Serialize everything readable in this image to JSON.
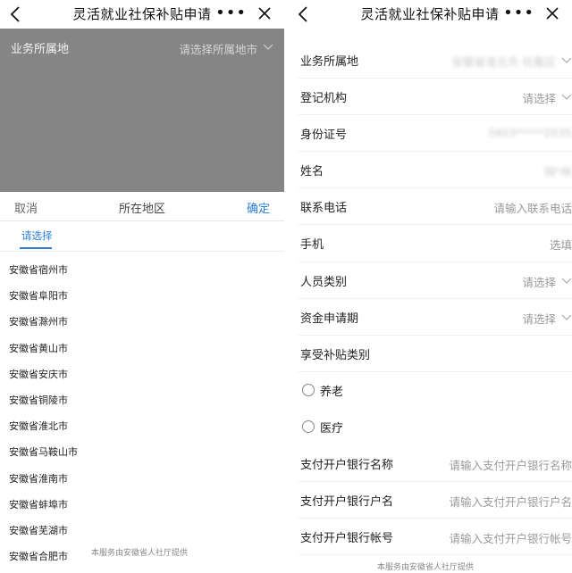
{
  "left": {
    "header": {
      "title": "灵活就业社保补贴申请",
      "more": "•••"
    },
    "overlay": {
      "label": "业务所属地",
      "placeholder": "请选择所属地市"
    },
    "picker": {
      "cancel": "取消",
      "title": "所在地区",
      "confirm": "确定",
      "tab": "请选择",
      "cities": [
        "安徽省宿州市",
        "安徽省阜阳市",
        "安徽省滁州市",
        "安徽省黄山市",
        "安徽省安庆市",
        "安徽省铜陵市",
        "安徽省淮北市",
        "安徽省马鞍山市",
        "安徽省淮南市",
        "安徽省蚌埠市",
        "安徽省芜湖市",
        "安徽省合肥市"
      ]
    },
    "footer": "本服务由安徽省人社厅提供"
  },
  "right": {
    "header": {
      "title": "灵活就业社保补贴申请",
      "more": "•••"
    },
    "form": {
      "region": {
        "label": "业务所属地",
        "value": "安徽省淮北市 杜集区"
      },
      "registration_org": {
        "label": "登记机构",
        "placeholder": "请选择"
      },
      "id_number": {
        "label": "身份证号",
        "value": "3403*****2035"
      },
      "name": {
        "label": "姓名",
        "value": "钱*林"
      },
      "phone": {
        "label": "联系电话",
        "placeholder": "请输入联系电话"
      },
      "mobile": {
        "label": "手机",
        "placeholder": "选填"
      },
      "person_type": {
        "label": "人员类别",
        "placeholder": "请选择"
      },
      "fund_period": {
        "label": "资金申请期",
        "placeholder": "请选择"
      },
      "subsidy_type": {
        "label": "享受补贴类别"
      },
      "pension": {
        "label": "养老"
      },
      "medical": {
        "label": "医疗"
      },
      "bank_name": {
        "label": "支付开户银行名称",
        "placeholder": "请输入支付开户银行名称"
      },
      "bank_account_name": {
        "label": "支付开户银行户名",
        "placeholder": "请输入支付开户银行户名"
      },
      "bank_account_no": {
        "label": "支付开户银行帐号",
        "placeholder": "请输入支付开户银行帐号"
      }
    },
    "footer": "本服务由安徽省人社厅提供"
  }
}
